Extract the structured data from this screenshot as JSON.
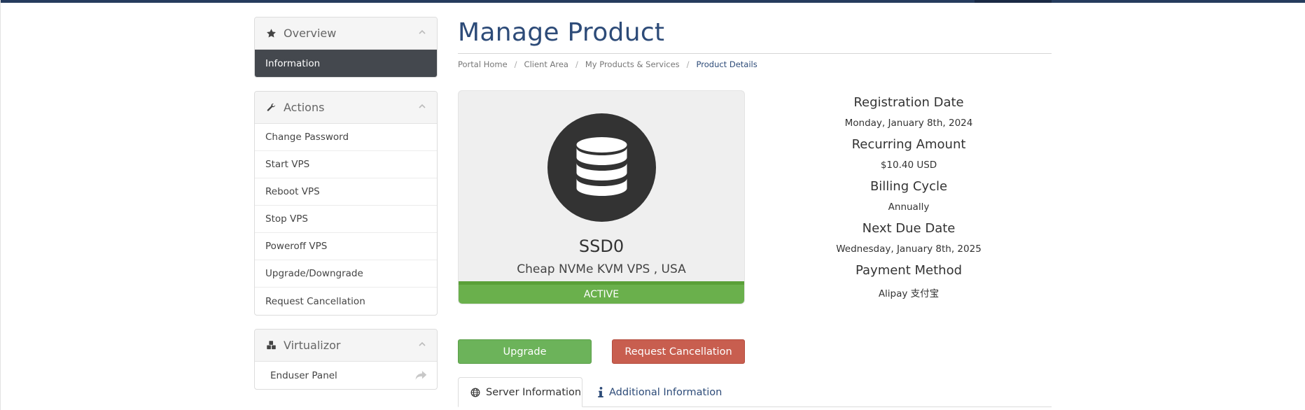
{
  "sidebar": {
    "overview": {
      "title": "Overview",
      "items": [
        {
          "label": "Information"
        }
      ]
    },
    "actions": {
      "title": "Actions",
      "items": [
        {
          "label": "Change Password"
        },
        {
          "label": "Start VPS"
        },
        {
          "label": "Reboot VPS"
        },
        {
          "label": "Stop VPS"
        },
        {
          "label": "Poweroff VPS"
        },
        {
          "label": "Upgrade/Downgrade"
        },
        {
          "label": "Request Cancellation"
        }
      ]
    },
    "virtualizor": {
      "title": "Virtualizor",
      "items": [
        {
          "label": "Enduser Panel"
        }
      ]
    }
  },
  "main": {
    "title": "Manage Product",
    "breadcrumb": [
      "Portal Home",
      "Client Area",
      "My Products & Services",
      "Product Details"
    ],
    "product": {
      "name": "SSD0",
      "group": "Cheap NVMe KVM VPS , USA",
      "status": "ACTIVE",
      "icon": "database-icon"
    },
    "buttons": {
      "upgrade": "Upgrade",
      "cancel": "Request Cancellation"
    },
    "details": [
      {
        "label": "Registration Date",
        "value": "Monday, January 8th, 2024"
      },
      {
        "label": "Recurring Amount",
        "value": "$10.40 USD"
      },
      {
        "label": "Billing Cycle",
        "value": "Annually"
      },
      {
        "label": "Next Due Date",
        "value": "Wednesday, January 8th, 2025"
      },
      {
        "label": "Payment Method",
        "value": "Alipay 支付宝"
      }
    ],
    "tabs": [
      {
        "label": "Server Information",
        "icon": "globe-icon",
        "active": true
      },
      {
        "label": "Additional Information",
        "icon": "info-icon",
        "active": false
      }
    ]
  },
  "colors": {
    "brand": "#2d4b78",
    "topbar": "#253b5d",
    "active_nav": "#44484e",
    "status_active": "#6ab04c",
    "upgrade": "#6cb35a",
    "cancel": "#c85e4f"
  }
}
